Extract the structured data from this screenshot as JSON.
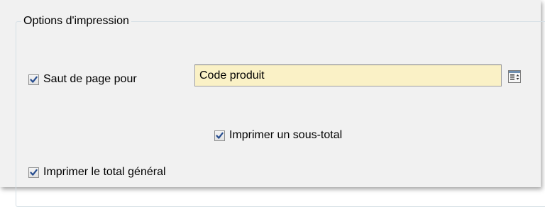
{
  "group": {
    "title": "Options d'impression"
  },
  "page_break": {
    "checked": true,
    "label": "Saut de page pour",
    "field_value": "Code produit",
    "picker_icon": "list-picker-icon"
  },
  "subtotal": {
    "checked": true,
    "label": "Imprimer un sous-total"
  },
  "grand_total": {
    "checked": true,
    "label": "Imprimer le total général"
  },
  "colors": {
    "panel_background": "#f1f1f1",
    "field_background": "#faf1c6",
    "check_mark": "#264c8e"
  }
}
